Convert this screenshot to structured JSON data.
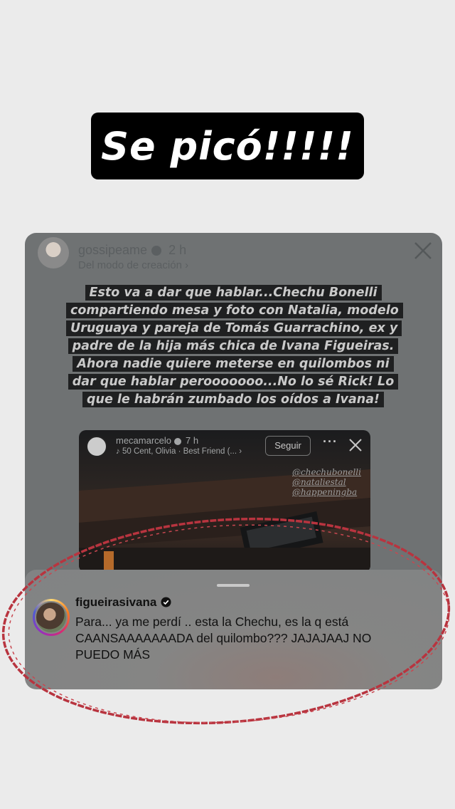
{
  "headline": {
    "text": "Se picó!!!!!"
  },
  "story": {
    "username": "gossipeame",
    "time": "2 h",
    "subtitle": "Del modo de creación",
    "subtitle_chevron": "›",
    "caption": "Esto va a dar que hablar...Chechu Bonelli compartiendo mesa y foto con Natalia, modelo Uruguaya y pareja de Tomás Guarrachino, ex y padre de la hija más chica de Ivana Figueiras. Ahora nadie quiere meterse en quilombos ni dar que hablar perooooooo...No lo sé Rick! Lo que le habrán zumbado los oídos a Ivana!",
    "close_icon": "close-icon"
  },
  "inner_post": {
    "username": "mecamarcelo",
    "time": "7 h",
    "music": "50 Cent, Olivia · Best Friend (...",
    "music_more": "›",
    "follow_label": "Seguir",
    "more_label": "···",
    "tags": [
      "@chechubonelli",
      "@nataliestal",
      "@happeningba"
    ]
  },
  "comment": {
    "username": "figueirasivana",
    "text": "Para... ya me perdí .. esta la Chechu, es la q está CAANSAAAAAAADA del quilombo??? JAJAJAAJ NO PUEDO MÁS"
  },
  "colors": {
    "background": "#ebebeb",
    "headline_bg": "#000000",
    "story_bg": "#6f7273",
    "annotation_red": "#b8343f"
  }
}
